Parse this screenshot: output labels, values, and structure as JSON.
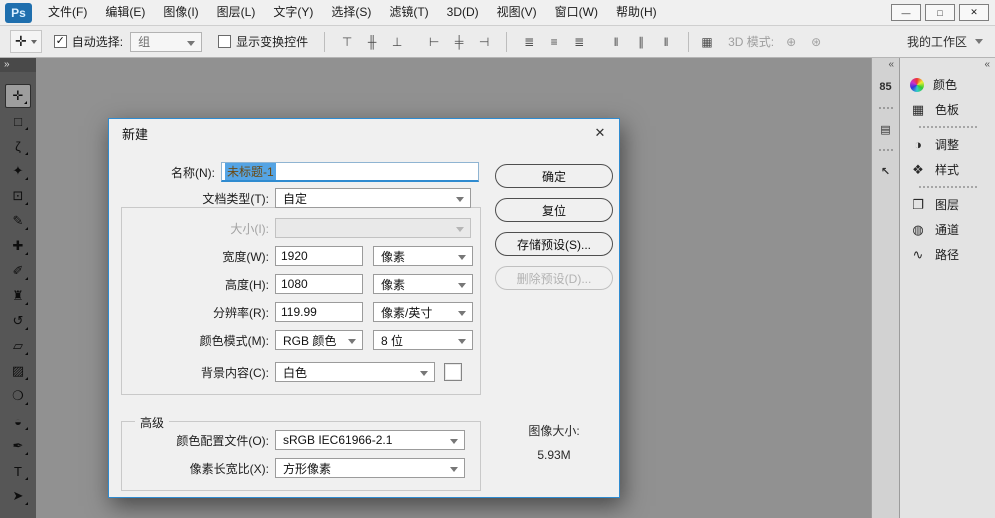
{
  "colors": {
    "accent": "#2f8bd0",
    "logo-bg": "#1f6fae",
    "selection-bg": "#55a4e4",
    "selection-text": "#6b4a14"
  },
  "titlebar": {
    "logo": "Ps",
    "menus": [
      "文件(F)",
      "编辑(E)",
      "图像(I)",
      "图层(L)",
      "文字(Y)",
      "选择(S)",
      "滤镜(T)",
      "3D(D)",
      "视图(V)",
      "窗口(W)",
      "帮助(H)"
    ],
    "window_controls": {
      "minimize": "—",
      "maximize": "□",
      "close": "✕"
    }
  },
  "options_bar": {
    "tool_icon": "✛",
    "auto_select_label": "自动选择:",
    "auto_select_checked": true,
    "group_value": "组",
    "show_transform_label": "显示变换控件",
    "show_transform_checked": false,
    "align_icons": [
      {
        "name": "align-top-edges-icon",
        "glyph": "⊤"
      },
      {
        "name": "align-vertical-centers-icon",
        "glyph": "╫"
      },
      {
        "name": "align-bottom-edges-icon",
        "glyph": "⊥"
      },
      {
        "name": "align-left-edges-icon",
        "glyph": "⊢"
      },
      {
        "name": "align-horizontal-centers-icon",
        "glyph": "╪"
      },
      {
        "name": "align-right-edges-icon",
        "glyph": "⊣"
      }
    ],
    "distribute_icons": [
      {
        "name": "distribute-top-edges-icon",
        "glyph": "≣"
      },
      {
        "name": "distribute-vertical-centers-icon",
        "glyph": "≡"
      },
      {
        "name": "distribute-bottom-edges-icon",
        "glyph": "≣"
      },
      {
        "name": "distribute-left-edges-icon",
        "glyph": "‖"
      },
      {
        "name": "distribute-horizontal-centers-icon",
        "glyph": "∥"
      },
      {
        "name": "distribute-right-edges-icon",
        "glyph": "‖"
      }
    ],
    "auto_align_icon": "▦",
    "mode3d_label": "3D 模式:",
    "mode3d_icons": [
      {
        "name": "3d-rotate-icon",
        "glyph": "⊕",
        "class": "dim"
      },
      {
        "name": "3d-roll-icon",
        "glyph": "⊛",
        "class": "dim"
      }
    ],
    "workspace_value": "我的工作区"
  },
  "toolbar": {
    "expand_icon": "»",
    "tools": [
      {
        "name": "tool-move",
        "glyph": "✛",
        "selected": true
      },
      {
        "name": "tool-rectangular-marquee",
        "glyph": "□"
      },
      {
        "name": "tool-lasso",
        "glyph": "ζ"
      },
      {
        "name": "tool-quick-selection",
        "glyph": "✦"
      },
      {
        "name": "tool-crop",
        "glyph": "⊡"
      },
      {
        "name": "tool-eyedropper",
        "glyph": "✎"
      },
      {
        "name": "tool-spot-healing-brush",
        "glyph": "✚"
      },
      {
        "name": "tool-brush",
        "glyph": "✐"
      },
      {
        "name": "tool-clone-stamp",
        "glyph": "♜"
      },
      {
        "name": "tool-history-brush",
        "glyph": "↺"
      },
      {
        "name": "tool-eraser",
        "glyph": "▱"
      },
      {
        "name": "tool-gradient",
        "glyph": "▨"
      },
      {
        "name": "tool-blur",
        "glyph": "❍"
      },
      {
        "name": "tool-dodge",
        "glyph": "◒"
      },
      {
        "name": "tool-pen",
        "glyph": "✒"
      },
      {
        "name": "tool-type",
        "glyph": "T"
      },
      {
        "name": "tool-path-selection",
        "glyph": "➤"
      }
    ]
  },
  "panels": {
    "strip": {
      "collapse_icon": "«",
      "info_icon": "85",
      "histogram_icon": "▤",
      "history_icon": "↖"
    },
    "dock": {
      "collapse_icon": "«",
      "tabs": {
        "color": {
          "label": "颜色"
        },
        "swatches": {
          "label": "色板",
          "icon": "▦"
        },
        "adjustments": {
          "label": "调整",
          "icon": "◑"
        },
        "styles": {
          "label": "样式",
          "icon": "❖"
        },
        "layers": {
          "label": "图层",
          "icon": "❐"
        },
        "channels": {
          "label": "通道",
          "icon": "◍"
        },
        "paths": {
          "label": "路径",
          "icon": "∿"
        }
      }
    }
  },
  "dialog": {
    "title": "新建",
    "close_icon": "✕",
    "name": {
      "label": "名称(N):",
      "value": "未标题-1"
    },
    "doc_type": {
      "label": "文档类型(T):",
      "value": "自定"
    },
    "size": {
      "label": "大小(I):",
      "value": ""
    },
    "width": {
      "label": "宽度(W):",
      "value": "1920",
      "unit": "像素"
    },
    "height": {
      "label": "高度(H):",
      "value": "1080",
      "unit": "像素"
    },
    "resolution": {
      "label": "分辨率(R):",
      "value": "119.99",
      "unit": "像素/英寸"
    },
    "color_mode": {
      "label": "颜色模式(M):",
      "value": "RGB 颜色",
      "depth": "8 位"
    },
    "background": {
      "label": "背景内容(C):",
      "value": "白色"
    },
    "advanced": {
      "legend": "高级",
      "color_profile": {
        "label": "颜色配置文件(O):",
        "value": "sRGB IEC61966-2.1"
      },
      "pixel_aspect": {
        "label": "像素长宽比(X):",
        "value": "方形像素"
      }
    },
    "buttons": {
      "ok": "确定",
      "reset": "复位",
      "save_preset": "存储预设(S)...",
      "delete_preset": "删除预设(D)..."
    },
    "image_size": {
      "label": "图像大小:",
      "value": "5.93M"
    }
  }
}
